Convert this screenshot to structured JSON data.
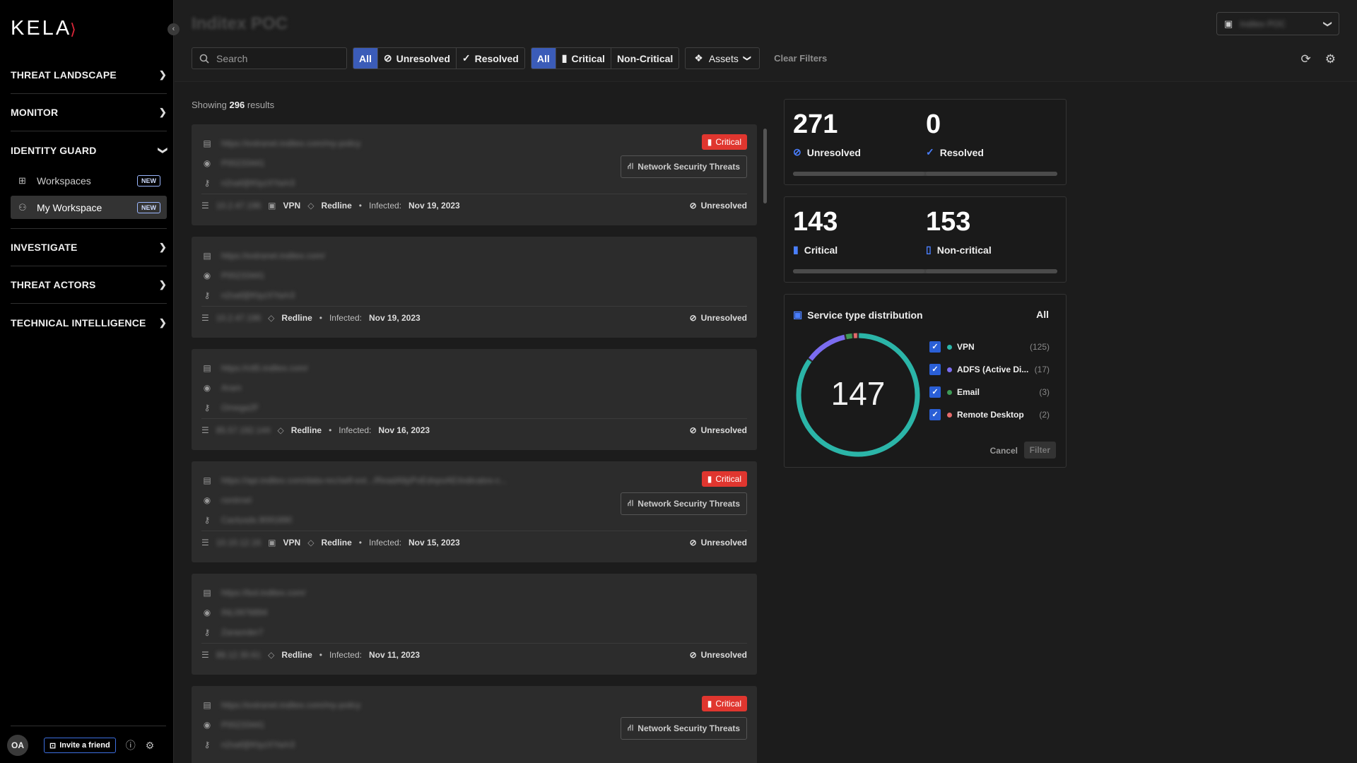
{
  "brand": {
    "logo": "KELA"
  },
  "sidebar": {
    "items": [
      {
        "label": "THREAT LANDSCAPE"
      },
      {
        "label": "MONITOR"
      },
      {
        "label": "IDENTITY GUARD"
      },
      {
        "label": "INVESTIGATE"
      },
      {
        "label": "THREAT ACTORS"
      },
      {
        "label": "TECHNICAL INTELLIGENCE"
      }
    ],
    "sub_items": [
      {
        "label": "Workspaces",
        "badge": "NEW"
      },
      {
        "label": "My Workspace",
        "badge": "NEW"
      }
    ],
    "avatar": "OA",
    "invite_label": "Invite a friend"
  },
  "header": {
    "title": "Inditex POC",
    "workspace_value": "Inditex POC"
  },
  "filters": {
    "search_placeholder": "Search",
    "status": [
      {
        "label": "All"
      },
      {
        "label": "Unresolved"
      },
      {
        "label": "Resolved"
      }
    ],
    "severity": [
      {
        "label": "All"
      },
      {
        "label": "Critical"
      },
      {
        "label": "Non-Critical"
      }
    ],
    "assets_label": "Assets",
    "clear_label": "Clear Filters"
  },
  "results": {
    "prefix": "Showing",
    "count": "296",
    "suffix": "results"
  },
  "cards": [
    {
      "url": "https://extranet.inditex.com/my-policy",
      "user": "P00233441",
      "password": "n2oaf@KtyzXYa/n3",
      "ip": "10.2.47.196",
      "service": "VPN",
      "stealer": "Redline",
      "infected_label": "Infected:",
      "infected": "Nov 19, 2023",
      "status": "Unresolved",
      "critical": "Critical",
      "tag": "Network Security Threats"
    },
    {
      "url": "https://extranet.inditex.com/",
      "user": "P00233441",
      "password": "n2oaf@KtyzXYa/n3",
      "ip": "10.2.47.196",
      "service": "",
      "stealer": "Redline",
      "infected_label": "Infected:",
      "infected": "Nov 19, 2023",
      "status": "Unresolved",
      "critical": "",
      "tag": ""
    },
    {
      "url": "https://ctt5.inditex.com/",
      "user": "Aram",
      "password": "Omega2F",
      "ip": "85.57.192.144",
      "service": "",
      "stealer": "Redline",
      "infected_label": "Infected:",
      "infected": "Nov 16, 2023",
      "status": "Unresolved",
      "critical": "",
      "tag": ""
    },
    {
      "url": "https://api.inditex.com/data-rec/self-ext.../ReadAlIpPoEdnpoAE/indicatos-c...",
      "user": "rsmirnel",
      "password": "Cactusdx.9091890",
      "ip": "10.10.12.16",
      "service": "VPN",
      "stealer": "Redline",
      "infected_label": "Infected:",
      "infected": "Nov 15, 2023",
      "status": "Unresolved",
      "critical": "Critical",
      "tag": "Network Security Threats"
    },
    {
      "url": "https://bol.inditex.com/",
      "user": "INL0976894",
      "password": "Zaraorder7",
      "ip": "88.12.30.61",
      "service": "",
      "stealer": "Redline",
      "infected_label": "Infected:",
      "infected": "Nov 11, 2023",
      "status": "Unresolved",
      "critical": "",
      "tag": ""
    },
    {
      "url": "https://extranet.inditex.com/my-policy",
      "user": "P00233441",
      "password": "n2oaf@KtyzXYa/n3",
      "ip": "",
      "service": "",
      "stealer": "",
      "infected_label": "",
      "infected": "",
      "status": "",
      "critical": "Critical",
      "tag": "Network Security Threats"
    }
  ],
  "stats": {
    "unresolved": {
      "value": "271",
      "label": "Unresolved"
    },
    "resolved": {
      "value": "0",
      "label": "Resolved"
    },
    "critical": {
      "value": "143",
      "label": "Critical"
    },
    "noncritical": {
      "value": "153",
      "label": "Non-critical"
    }
  },
  "service_dist": {
    "title": "Service type distribution",
    "all_label": "All",
    "total": "147",
    "items": [
      {
        "name": "VPN",
        "count": "(125)",
        "value": 125,
        "color": "#2bb5a8"
      },
      {
        "name": "ADFS (Active Di...",
        "count": "(17)",
        "value": 17,
        "color": "#7b6cf0"
      },
      {
        "name": "Email",
        "count": "(3)",
        "value": 3,
        "color": "#3e9a56"
      },
      {
        "name": "Remote Desktop",
        "count": "(2)",
        "value": 2,
        "color": "#e56a6a"
      }
    ],
    "cancel_label": "Cancel",
    "filter_label": "Filter"
  }
}
